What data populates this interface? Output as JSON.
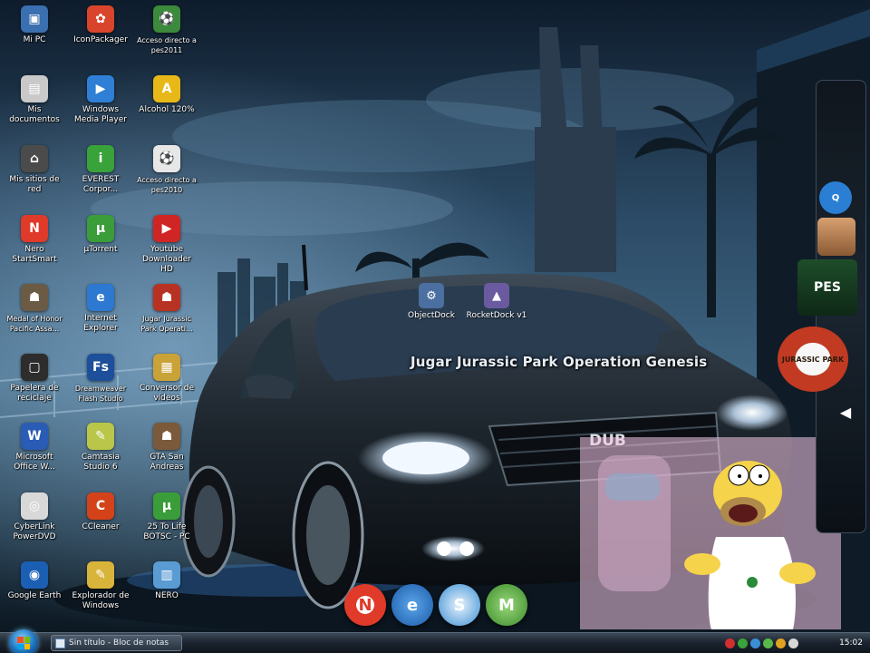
{
  "desktop": {
    "icons": [
      {
        "label": "Mi PC",
        "icon": "computer-icon",
        "color": "#3a6fb0"
      },
      {
        "label": "IconPackager",
        "icon": "iconpackager-icon",
        "color": "#d8452c"
      },
      {
        "label": "Acceso directo a pes2011",
        "icon": "pes2011-shortcut-icon",
        "color": "#3c8a3c"
      },
      {
        "label": "Mis documentos",
        "icon": "documents-folder-icon",
        "color": "#c9c9c9"
      },
      {
        "label": "Windows Media Player",
        "icon": "media-player-icon",
        "color": "#2f7fd6"
      },
      {
        "label": "Alcohol 120%",
        "icon": "alcohol-icon",
        "color": "#e8b818"
      },
      {
        "label": "Mis sitios de red",
        "icon": "network-places-icon",
        "color": "#4b4b4b"
      },
      {
        "label": "EVEREST Corpor...",
        "icon": "everest-icon",
        "color": "#3aa23a"
      },
      {
        "label": "Acceso directo a pes2010",
        "icon": "pes2010-shortcut-icon",
        "color": "#e7e7e7"
      },
      {
        "label": "Nero StartSmart",
        "icon": "nero-icon",
        "color": "#e03a2a"
      },
      {
        "label": "µTorrent",
        "icon": "utorrent-icon",
        "color": "#3a9d3a"
      },
      {
        "label": "Youtube Downloader HD",
        "icon": "youtube-downloader-icon",
        "color": "#d02525"
      },
      {
        "label": "Medal of Honor Pacific Assa...",
        "icon": "medal-of-honor-icon",
        "color": "#6b5a44"
      },
      {
        "label": "Internet Explorer",
        "icon": "internet-explorer-icon",
        "color": "#2d78d0"
      },
      {
        "label": "Jugar Jurassic Park Operati...",
        "icon": "jurassic-park-icon",
        "color": "#b83224"
      },
      {
        "label": "Papelera de reciclaje",
        "icon": "recycle-bin-icon",
        "color": "#2d2d2d"
      },
      {
        "label": "Dreamweaver Flash Studio",
        "icon": "flash-studio-icon",
        "color": "#1d4f9a"
      },
      {
        "label": "Conversor de vídeos",
        "icon": "video-converter-icon",
        "color": "#c9a238"
      },
      {
        "label": "Microsoft Office W...",
        "icon": "word-icon",
        "color": "#2a5bb5"
      },
      {
        "label": "Camtasia Studio 6",
        "icon": "camtasia-icon",
        "color": "#b9c64a"
      },
      {
        "label": "GTA San Andreas",
        "icon": "gta-icon",
        "color": "#7a5a3a"
      },
      {
        "label": "CyberLink PowerDVD",
        "icon": "powerdvd-icon",
        "color": "#d8d8d8"
      },
      {
        "label": "CCleaner",
        "icon": "ccleaner-icon",
        "color": "#d4421a"
      },
      {
        "label": "25 To Life BOTSC - PC",
        "icon": "utorrent-file-icon",
        "color": "#3a9d3a"
      },
      {
        "label": "Google Earth",
        "icon": "google-earth-icon",
        "color": "#1a5fb4"
      },
      {
        "label": "Explorador de Windows",
        "icon": "windows-explorer-icon",
        "color": "#d8b43a"
      },
      {
        "label": "NERO",
        "icon": "nero-file-icon",
        "color": "#5a9bd4"
      }
    ],
    "center_icons": [
      {
        "label": "ObjectDock",
        "icon": "objectdock-icon",
        "color": "#4a6fa0"
      },
      {
        "label": "RocketDock v1",
        "icon": "rocketdock-icon",
        "color": "#6a5aa0"
      }
    ],
    "overlay_caption": "Jugar Jurassic Park Operation Genesis",
    "watermark": "DUB"
  },
  "right_dock": {
    "items": [
      {
        "name": "quicktime-icon",
        "text": "Q",
        "color": "#2a7fd4"
      },
      {
        "name": "avatar-icon",
        "text": "",
        "color": "#b07040"
      },
      {
        "name": "pes-dock-icon",
        "text": "PES",
        "color": "#1e4d2a"
      },
      {
        "name": "jurassic-park-dock-icon",
        "text": "JURASSIC PARK",
        "color": "#c23a22"
      }
    ]
  },
  "bottom_dock": {
    "items": [
      {
        "name": "nero-dock-icon",
        "text": "N",
        "color": "#e03a2a"
      },
      {
        "name": "internet-explorer-dock-icon",
        "text": "e",
        "color": "#2d78d0"
      },
      {
        "name": "safari-dock-icon",
        "text": "S",
        "color": "#3a8fd4"
      },
      {
        "name": "messenger-dock-icon",
        "text": "M",
        "color": "#5ab84a"
      }
    ]
  },
  "taskbar": {
    "active_window": "Sin título - Bloc de notas",
    "clock": "15:02",
    "accent": "#1b6fb8"
  }
}
